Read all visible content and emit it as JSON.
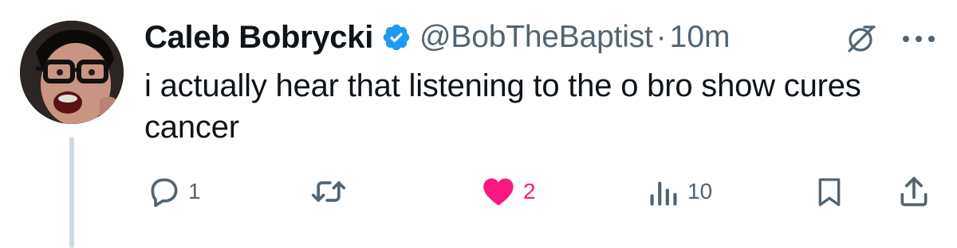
{
  "author": {
    "name": "Caleb Bobrycki",
    "handle": "@BobTheBaptist",
    "separator": "·",
    "time": "10m",
    "verified": true,
    "verified_color": "#1d9bf0"
  },
  "tweet": {
    "text": "i actually hear that listening to the o bro show cures cancer"
  },
  "actions": {
    "reply": {
      "icon": "reply-icon",
      "count": "1"
    },
    "repost": {
      "icon": "repost-icon",
      "count": ""
    },
    "like": {
      "icon": "heart-icon",
      "count": "2",
      "liked": true,
      "color": "#f91880"
    },
    "views": {
      "icon": "views-icon",
      "count": "10"
    },
    "bookmark": {
      "icon": "bookmark-icon"
    },
    "share": {
      "icon": "share-icon"
    }
  },
  "icons": {
    "grok": "grok-icon",
    "more": "more-icon"
  },
  "colors": {
    "text": "#0f1419",
    "secondary": "#536471",
    "thread_line": "#cfd9de"
  }
}
